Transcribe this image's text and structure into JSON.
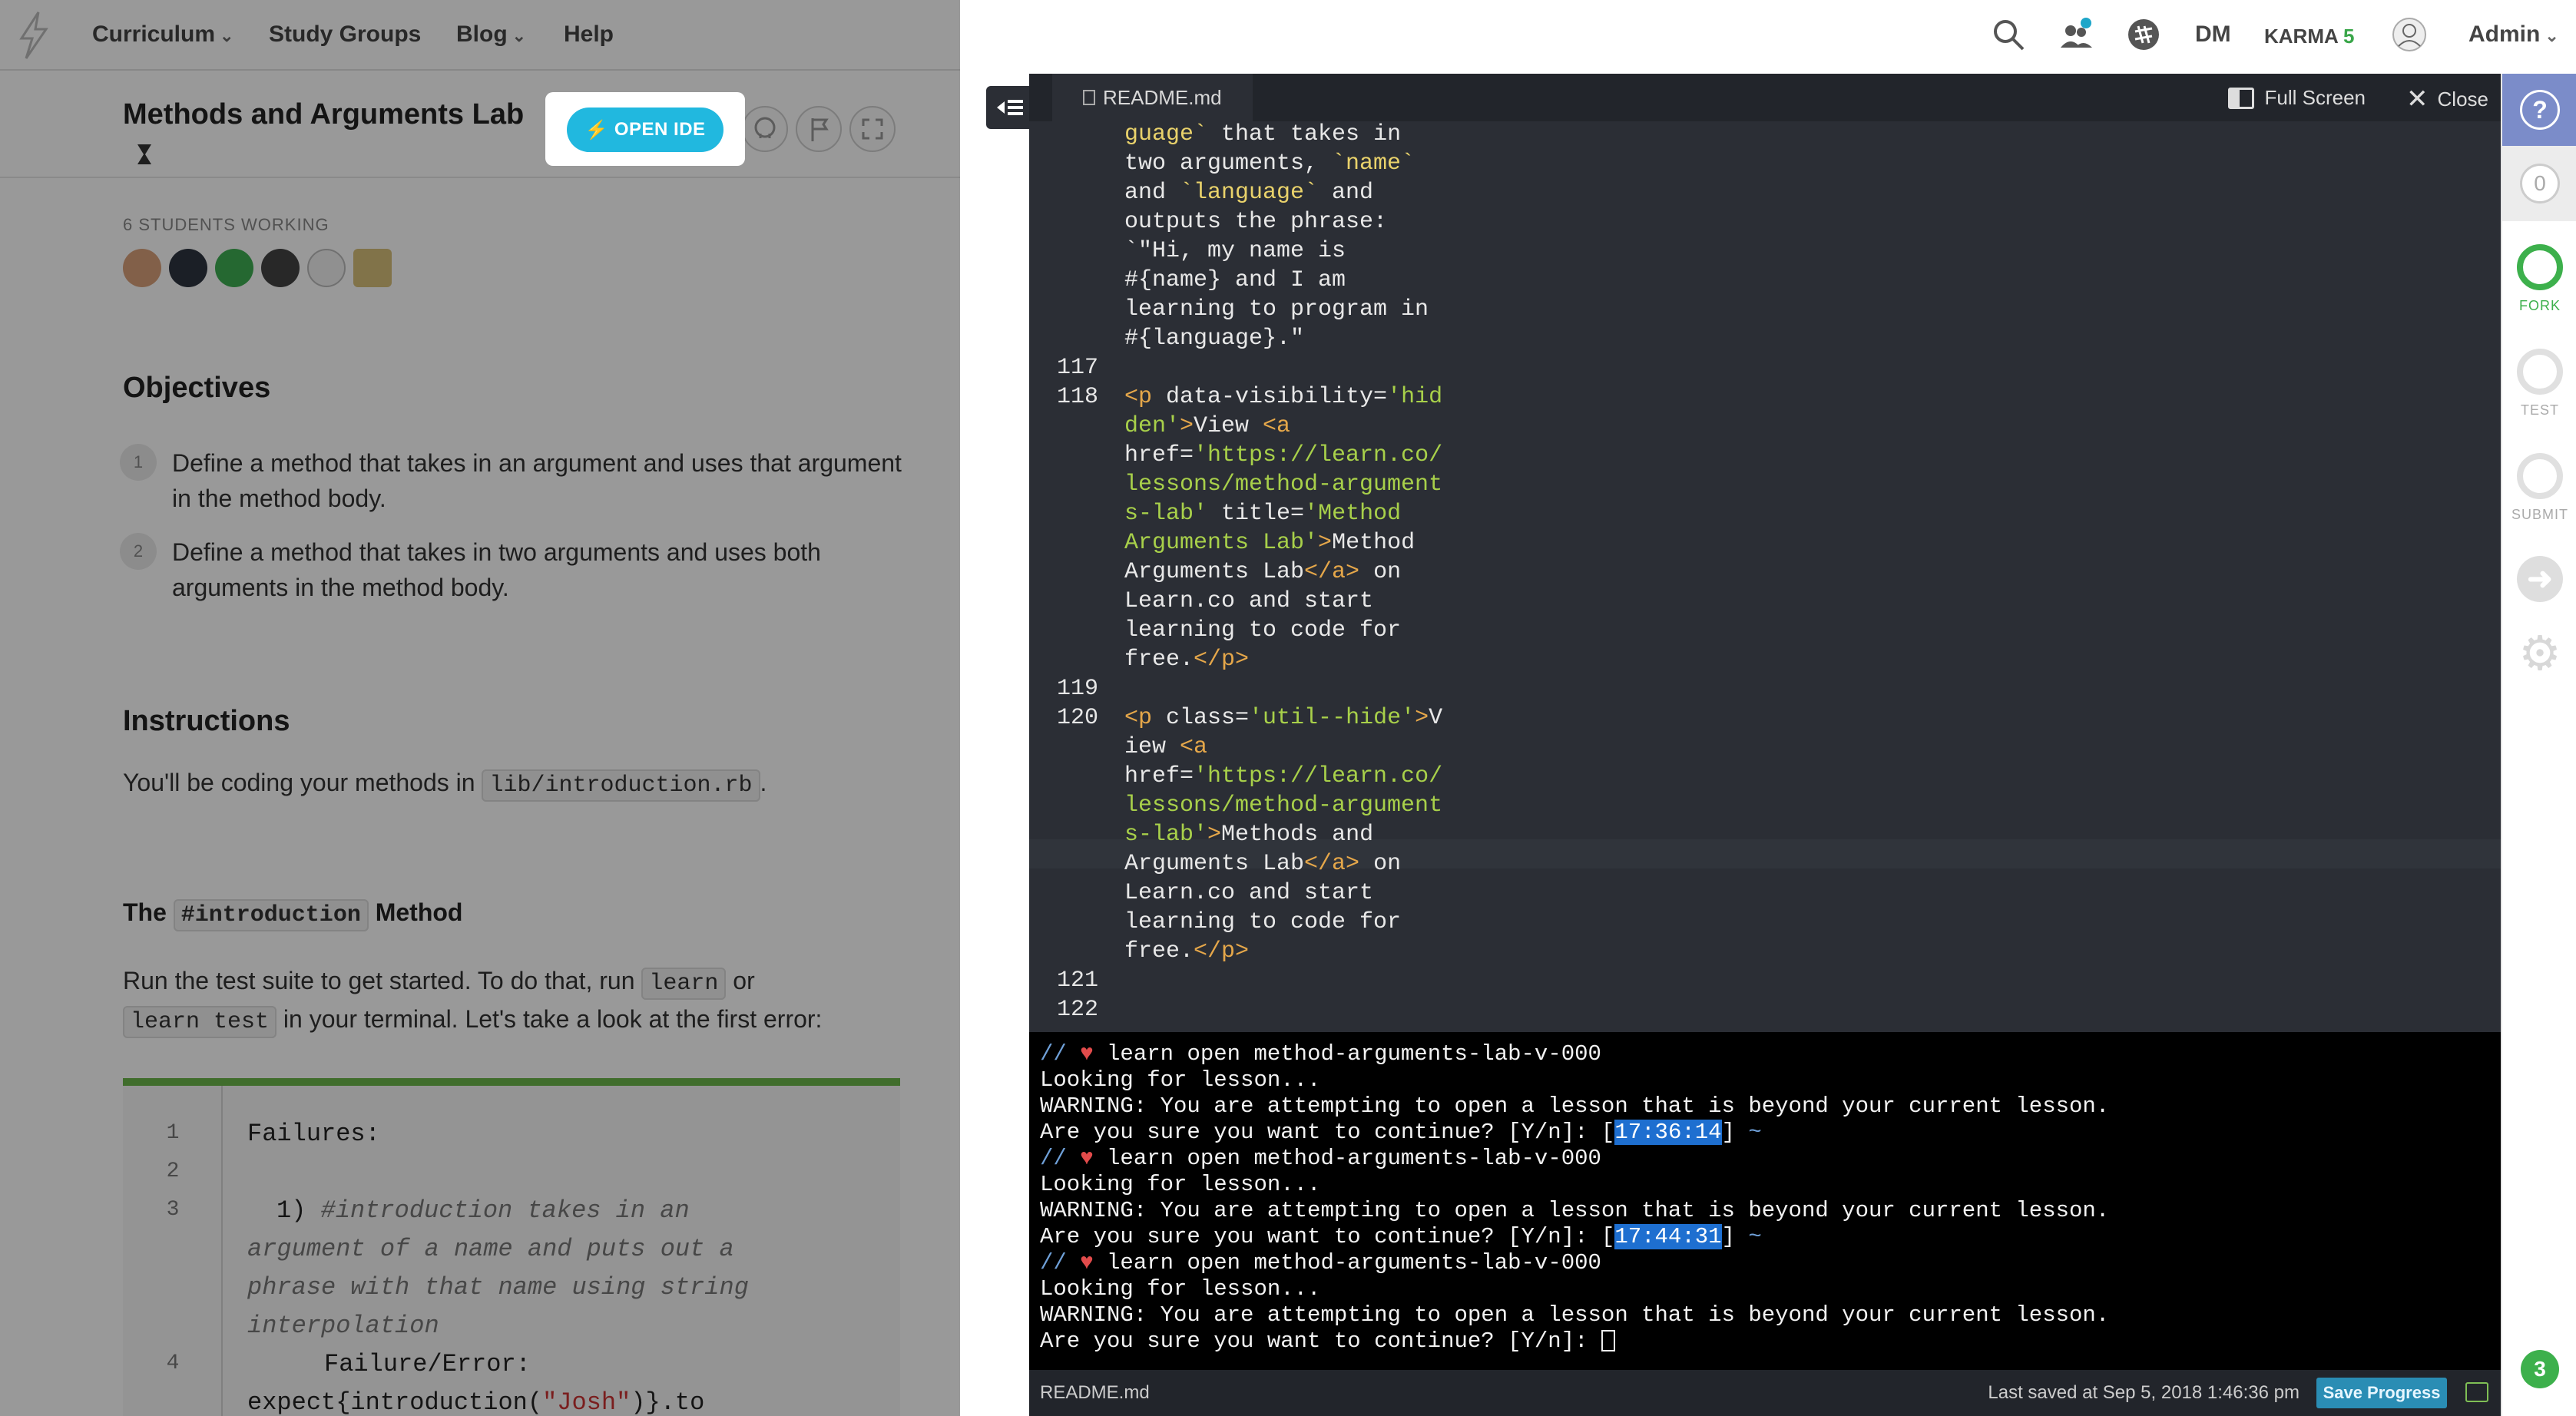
{
  "nav": {
    "items": [
      {
        "label": "Curriculum",
        "has_menu": true
      },
      {
        "label": "Study Groups",
        "has_menu": false
      },
      {
        "label": "Blog",
        "has_menu": true
      },
      {
        "label": "Help",
        "has_menu": false
      }
    ],
    "initials": "DM",
    "karma_label": "KARMA",
    "karma_value": "5",
    "user_label": "Admin"
  },
  "lesson": {
    "title": "Methods and Arguments Lab",
    "open_ide_label": "OPEN IDE",
    "students_working": "6 STUDENTS WORKING",
    "objectives_heading": "Objectives",
    "objectives": [
      {
        "num": "1",
        "text": "Define a method that takes in an argument and uses that argument in the method body."
      },
      {
        "num": "2",
        "text": "Define a method that takes in two arguments and uses both arguments in the method body."
      }
    ],
    "instructions_heading": "Instructions",
    "instructions_pre": "You'll be coding your methods in ",
    "instructions_code": "lib/introduction.rb",
    "instructions_post": ".",
    "method_heading_pre": "The ",
    "method_heading_code": "#introduction",
    "method_heading_post": " Method",
    "run_pre": "Run the test suite to get started. To do that, run ",
    "run_code1": "learn",
    "run_mid": " or",
    "run_code2": "learn test",
    "run_post": " in your terminal. Let's take a look at the first error:",
    "code_lines": {
      "ln1": "1",
      "ln2": "2",
      "ln3": "3",
      "ln4": "4",
      "l1": "Failures:",
      "l3a": "1) ",
      "l3b": "#introduction takes in an",
      "l3c": "argument of a name and puts out a",
      "l3d": "phrase with that name using string",
      "l3e": "interpolation",
      "l4a": "Failure/Error:",
      "l4b": "expect{introduction(",
      "l4c": "\"Josh\"",
      "l4d": ")}.to"
    }
  },
  "ide": {
    "tab_label": "README.md",
    "fullscreen_label": "Full Screen",
    "close_label": "Close",
    "editor_lines": [
      {
        "ln": "",
        "parts": [
          [
            "code",
            "guage`"
          ],
          [
            "txt",
            " that takes in"
          ]
        ]
      },
      {
        "ln": "",
        "parts": [
          [
            "txt",
            "two arguments, "
          ],
          [
            "code",
            "`name`"
          ]
        ]
      },
      {
        "ln": "",
        "parts": [
          [
            "txt",
            "and "
          ],
          [
            "code",
            "`language`"
          ],
          [
            "txt",
            " and"
          ]
        ]
      },
      {
        "ln": "",
        "parts": [
          [
            "txt",
            "outputs the phrase:"
          ]
        ]
      },
      {
        "ln": "",
        "parts": [
          [
            "txt",
            "`\"Hi, my name is"
          ]
        ]
      },
      {
        "ln": "",
        "parts": [
          [
            "txt",
            "#{name} and I am"
          ]
        ]
      },
      {
        "ln": "",
        "parts": [
          [
            "txt",
            "learning to program in"
          ]
        ]
      },
      {
        "ln": "",
        "parts": [
          [
            "txt",
            "#{language}.\""
          ]
        ]
      },
      {
        "ln": "117",
        "parts": []
      },
      {
        "ln": "118",
        "parts": [
          [
            "tag",
            "<p "
          ],
          [
            "txt",
            "data-visibility="
          ],
          [
            "str",
            "'hid"
          ]
        ]
      },
      {
        "ln": "",
        "parts": [
          [
            "str",
            "den'"
          ],
          [
            "tag",
            ">"
          ],
          [
            "txt",
            "View "
          ],
          [
            "tag",
            "<a"
          ]
        ]
      },
      {
        "ln": "",
        "parts": [
          [
            "txt",
            "href="
          ],
          [
            "str",
            "'https://learn.co/"
          ]
        ]
      },
      {
        "ln": "",
        "parts": [
          [
            "str",
            "lessons/method-argument"
          ]
        ]
      },
      {
        "ln": "",
        "parts": [
          [
            "str",
            "s-lab'"
          ],
          [
            "txt",
            " title="
          ],
          [
            "str",
            "'Method"
          ]
        ]
      },
      {
        "ln": "",
        "parts": [
          [
            "str",
            "Arguments Lab'"
          ],
          [
            "tag",
            ">"
          ],
          [
            "txt",
            "Method"
          ]
        ]
      },
      {
        "ln": "",
        "parts": [
          [
            "txt",
            "Arguments Lab"
          ],
          [
            "tag",
            "</a>"
          ],
          [
            "txt",
            " on"
          ]
        ]
      },
      {
        "ln": "",
        "parts": [
          [
            "txt",
            "Learn.co and start"
          ]
        ]
      },
      {
        "ln": "",
        "parts": [
          [
            "txt",
            "learning to code for"
          ]
        ]
      },
      {
        "ln": "",
        "parts": [
          [
            "txt",
            "free."
          ],
          [
            "tag",
            "</p>"
          ]
        ]
      },
      {
        "ln": "119",
        "parts": []
      },
      {
        "ln": "120",
        "parts": [
          [
            "tag",
            "<p "
          ],
          [
            "txt",
            "class="
          ],
          [
            "str",
            "'util--hide'"
          ],
          [
            "tag",
            ">"
          ],
          [
            "txt",
            "V"
          ]
        ]
      },
      {
        "ln": "",
        "parts": [
          [
            "txt",
            "iew "
          ],
          [
            "tag",
            "<a"
          ]
        ]
      },
      {
        "ln": "",
        "parts": [
          [
            "txt",
            "href="
          ],
          [
            "str",
            "'https://learn.co/"
          ]
        ]
      },
      {
        "ln": "",
        "parts": [
          [
            "str",
            "lessons/method-argument"
          ]
        ]
      },
      {
        "ln": "",
        "parts": [
          [
            "str",
            "s-lab'"
          ],
          [
            "tag",
            ">"
          ],
          [
            "txt",
            "Methods and"
          ]
        ]
      },
      {
        "ln": "",
        "parts": [
          [
            "txt",
            "Arguments Lab"
          ],
          [
            "tag",
            "</a>"
          ],
          [
            "txt",
            " on"
          ]
        ]
      },
      {
        "ln": "",
        "parts": [
          [
            "txt",
            "Learn.co and start"
          ]
        ]
      },
      {
        "ln": "",
        "parts": [
          [
            "txt",
            "learning to code for"
          ]
        ]
      },
      {
        "ln": "",
        "parts": [
          [
            "txt",
            "free."
          ],
          [
            "tag",
            "</p>"
          ]
        ]
      },
      {
        "ln": "121",
        "parts": []
      },
      {
        "ln": "122",
        "parts": []
      }
    ],
    "terminal": {
      "prompt_prefix": "// ",
      "heart": "♥",
      "cmd": " learn open method-arguments-lab-v-000",
      "looking": "Looking for lesson...",
      "warning": "WARNING: You are attempting to open a lesson that is beyond your current lesson.",
      "confirm": "Are you sure you want to continue? [Y/n]: ",
      "time1": "17:36:14",
      "time2": "17:44:31",
      "tilde": " ~"
    },
    "status": {
      "file": "README.md",
      "saved": "Last saved at Sep 5, 2018 1:46:36 pm",
      "save_btn": "Save Progress"
    }
  },
  "rail": {
    "help": "?",
    "count": "0",
    "fork_label": "FORK",
    "test_label": "TEST",
    "submit_label": "SUBMIT",
    "badge": "3"
  },
  "colors": {
    "accent": "#21b8df",
    "green": "#3db04c",
    "editor_bg": "#2b2e35",
    "terminal_bg": "#000000"
  }
}
